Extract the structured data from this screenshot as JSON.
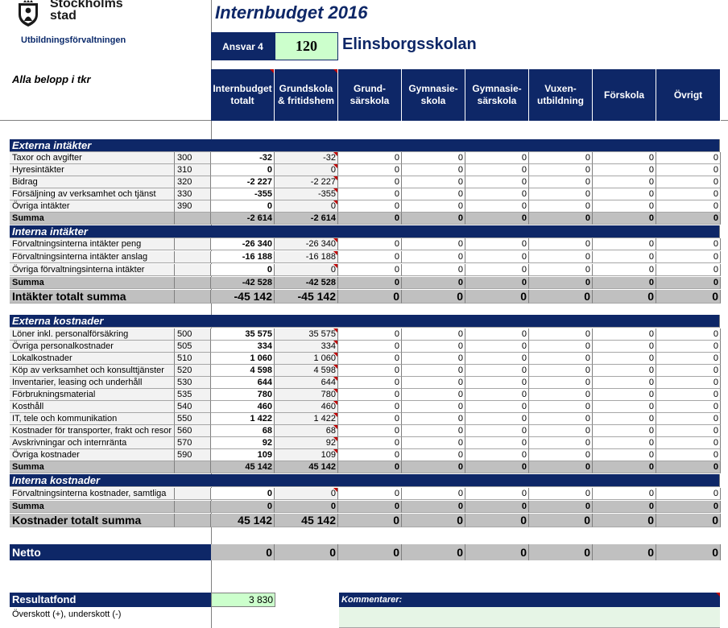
{
  "header": {
    "org_name_line1": "Stockholms",
    "org_name_line2": "stad",
    "org_sub": "Utbildningsförvaltningen",
    "title": "Internbudget 2016",
    "ansvar_label": "Ansvar 4",
    "ansvar_value": "120",
    "school_name": "Elinsborgsskolan",
    "belopp_note": "Alla belopp i tkr"
  },
  "columns": [
    "Internbudget\ntotalt",
    "Grundskola\n& fritidshem",
    "Grund-\nsärskola",
    "Gymnasie-\nskola",
    "Gymnasie-\nsärskola",
    "Vuxen-\nutbildning",
    "Förskola",
    "Övrigt"
  ],
  "sections": {
    "ext_intakter": {
      "title": "Externa intäkter",
      "rows": [
        {
          "label": "Taxor och avgifter",
          "code": "300",
          "values": [
            "-32",
            "-32",
            "0",
            "0",
            "0",
            "0",
            "0",
            "0"
          ]
        },
        {
          "label": "Hyresintäkter",
          "code": "310",
          "values": [
            "0",
            "0",
            "0",
            "0",
            "0",
            "0",
            "0",
            "0"
          ]
        },
        {
          "label": "Bidrag",
          "code": "320",
          "values": [
            "-2 227",
            "-2 227",
            "0",
            "0",
            "0",
            "0",
            "0",
            "0"
          ]
        },
        {
          "label": "Försäljning av verksamhet och tjänst",
          "code": "330",
          "values": [
            "-355",
            "-355",
            "0",
            "0",
            "0",
            "0",
            "0",
            "0"
          ]
        },
        {
          "label": "Övriga intäkter",
          "code": "390",
          "values": [
            "0",
            "0",
            "0",
            "0",
            "0",
            "0",
            "0",
            "0"
          ]
        }
      ],
      "summa": {
        "label": "Summa",
        "values": [
          "-2 614",
          "-2 614",
          "0",
          "0",
          "0",
          "0",
          "0",
          "0"
        ]
      }
    },
    "int_intakter": {
      "title": "Interna intäkter",
      "rows": [
        {
          "label": "Förvaltningsinterna intäkter peng",
          "code": "",
          "values": [
            "-26 340",
            "-26 340",
            "0",
            "0",
            "0",
            "0",
            "0",
            "0"
          ]
        },
        {
          "label": "Förvaltningsinterna intäkter anslag",
          "code": "",
          "values": [
            "-16 188",
            "-16 188",
            "0",
            "0",
            "0",
            "0",
            "0",
            "0"
          ]
        },
        {
          "label": "Övriga förvaltningsinterna intäkter",
          "code": "",
          "values": [
            "0",
            "0",
            "0",
            "0",
            "0",
            "0",
            "0",
            "0"
          ]
        }
      ],
      "summa": {
        "label": "Summa",
        "values": [
          "-42 528",
          "-42 528",
          "0",
          "0",
          "0",
          "0",
          "0",
          "0"
        ]
      }
    },
    "intakter_totalt": {
      "label": "Intäkter totalt summa",
      "values": [
        "-45 142",
        "-45 142",
        "0",
        "0",
        "0",
        "0",
        "0",
        "0"
      ]
    },
    "ext_kostnader": {
      "title": "Externa kostnader",
      "rows": [
        {
          "label": "Löner inkl. personalförsäkring",
          "code": "500",
          "values": [
            "35 575",
            "35 575",
            "0",
            "0",
            "0",
            "0",
            "0",
            "0"
          ]
        },
        {
          "label": "Övriga personalkostnader",
          "code": "505",
          "values": [
            "334",
            "334",
            "0",
            "0",
            "0",
            "0",
            "0",
            "0"
          ]
        },
        {
          "label": "Lokalkostnader",
          "code": "510",
          "values": [
            "1 060",
            "1 060",
            "0",
            "0",
            "0",
            "0",
            "0",
            "0"
          ]
        },
        {
          "label": "Köp av verksamhet och konsulttjänster",
          "code": "520",
          "values": [
            "4 598",
            "4 598",
            "0",
            "0",
            "0",
            "0",
            "0",
            "0"
          ]
        },
        {
          "label": "Inventarier, leasing och underhåll",
          "code": "530",
          "values": [
            "644",
            "644",
            "0",
            "0",
            "0",
            "0",
            "0",
            "0"
          ]
        },
        {
          "label": "Förbrukningsmaterial",
          "code": "535",
          "values": [
            "780",
            "780",
            "0",
            "0",
            "0",
            "0",
            "0",
            "0"
          ]
        },
        {
          "label": "Kosthåll",
          "code": "540",
          "values": [
            "460",
            "460",
            "0",
            "0",
            "0",
            "0",
            "0",
            "0"
          ]
        },
        {
          "label": "IT, tele och kommunikation",
          "code": "550",
          "values": [
            "1 422",
            "1 422",
            "0",
            "0",
            "0",
            "0",
            "0",
            "0"
          ]
        },
        {
          "label": "Kostnader för transporter, frakt och resor",
          "code": "560",
          "values": [
            "68",
            "68",
            "0",
            "0",
            "0",
            "0",
            "0",
            "0"
          ]
        },
        {
          "label": "Avskrivningar och internränta",
          "code": "570",
          "values": [
            "92",
            "92",
            "0",
            "0",
            "0",
            "0",
            "0",
            "0"
          ]
        },
        {
          "label": "Övriga kostnader",
          "code": "590",
          "values": [
            "109",
            "109",
            "0",
            "0",
            "0",
            "0",
            "0",
            "0"
          ]
        }
      ],
      "summa": {
        "label": "Summa",
        "values": [
          "45 142",
          "45 142",
          "0",
          "0",
          "0",
          "0",
          "0",
          "0"
        ]
      }
    },
    "int_kostnader": {
      "title": "Interna kostnader",
      "rows": [
        {
          "label": "Förvaltningsinterna kostnader, samtliga",
          "code": "",
          "values": [
            "0",
            "0",
            "0",
            "0",
            "0",
            "0",
            "0",
            "0"
          ]
        }
      ],
      "summa": {
        "label": "Summa",
        "values": [
          "0",
          "0",
          "0",
          "0",
          "0",
          "0",
          "0",
          "0"
        ]
      }
    },
    "kostnader_totalt": {
      "label": "Kostnader totalt summa",
      "values": [
        "45 142",
        "45 142",
        "0",
        "0",
        "0",
        "0",
        "0",
        "0"
      ]
    }
  },
  "netto": {
    "label": "Netto",
    "values": [
      "0",
      "0",
      "0",
      "0",
      "0",
      "0",
      "0",
      "0"
    ]
  },
  "resultatfond": {
    "label": "Resultatfond",
    "value": "3 830",
    "sub": "Överskott (+), underskott (-)"
  },
  "kommentarer": {
    "label": "Kommentarer:"
  },
  "colors": {
    "navy": "#0e2767",
    "light_green": "#ccffcc",
    "grey": "#c0c0c0",
    "light_grey": "#f2f2f2"
  }
}
